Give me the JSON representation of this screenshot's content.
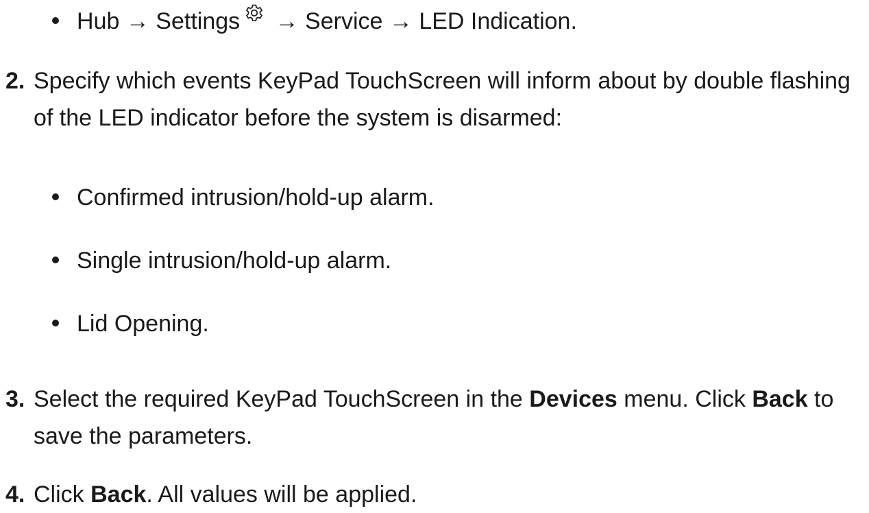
{
  "path_bullet": {
    "hub": "Hub",
    "arrow": "→",
    "settings": "Settings",
    "settings_icon": "gear-icon",
    "service": "Service",
    "led": "LED Indication."
  },
  "step2": {
    "number": "2.",
    "text": "Specify which events KeyPad TouchScreen will inform about by double flashing of the LED indicator before the system is disarmed:",
    "items": [
      "Confirmed intrusion/hold-up alarm.",
      "Single intrusion/hold-up alarm.",
      "Lid Opening."
    ]
  },
  "step3": {
    "number": "3.",
    "text_a": "Select the required KeyPad TouchScreen in the ",
    "bold_a": "Devices",
    "text_b": " menu. Click ",
    "bold_b": "Back",
    "text_c": " to save the parameters."
  },
  "step4": {
    "number": "4.",
    "text_a": "Click ",
    "bold_a": "Back",
    "text_b": ". All values will be applied."
  }
}
